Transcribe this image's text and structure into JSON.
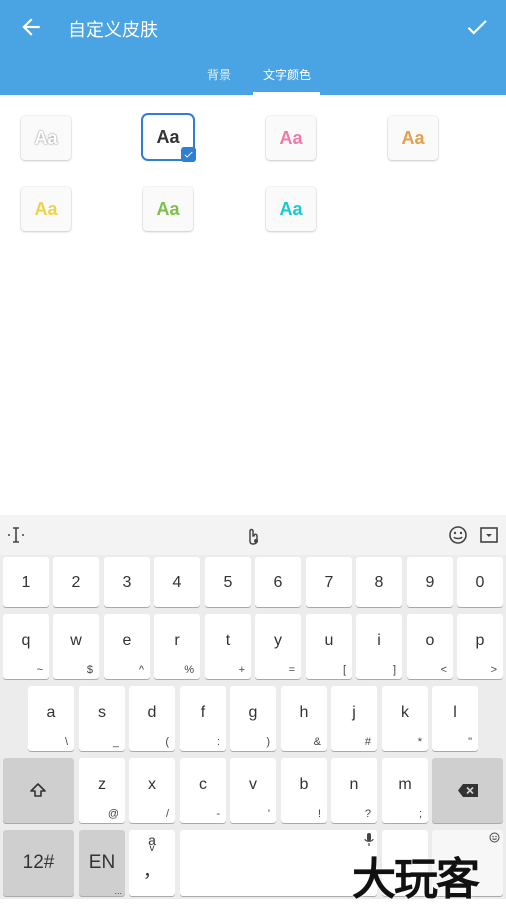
{
  "appbar": {
    "title": "自定义皮肤",
    "back_icon": "arrow-left-icon",
    "confirm_icon": "check-icon",
    "color": "#4aa3e3"
  },
  "tabs": [
    {
      "label": "背景",
      "active": false
    },
    {
      "label": "文字颜色",
      "active": true
    }
  ],
  "swatches": [
    {
      "label": "Aa",
      "color": "#ffffff",
      "outline": true,
      "selected": false
    },
    {
      "label": "Aa",
      "color": "#333333",
      "selected": true
    },
    {
      "label": "Aa",
      "color": "#f07aa6",
      "selected": false
    },
    {
      "label": "Aa",
      "color": "#e3a04a",
      "selected": false
    },
    {
      "label": "Aa",
      "color": "#eed34a",
      "selected": false
    },
    {
      "label": "Aa",
      "color": "#7cc04a",
      "selected": false
    },
    {
      "label": "Aa",
      "color": "#19c9d2",
      "selected": false
    }
  ],
  "keyboard": {
    "toolbar_icons": [
      "cursor-icon",
      "handwriting-icon",
      "emoji-icon",
      "hide-keyboard-icon"
    ],
    "numbers": [
      "1",
      "2",
      "3",
      "4",
      "5",
      "6",
      "7",
      "8",
      "9",
      "0"
    ],
    "row1": [
      {
        "m": "q",
        "s": "~"
      },
      {
        "m": "w",
        "s": "$"
      },
      {
        "m": "e",
        "s": "^"
      },
      {
        "m": "r",
        "s": "%"
      },
      {
        "m": "t",
        "s": "+"
      },
      {
        "m": "y",
        "s": "="
      },
      {
        "m": "u",
        "s": "["
      },
      {
        "m": "i",
        "s": "]"
      },
      {
        "m": "o",
        "s": "<"
      },
      {
        "m": "p",
        "s": ">"
      }
    ],
    "row2": [
      {
        "m": "a",
        "s": "\\"
      },
      {
        "m": "s",
        "s": "_"
      },
      {
        "m": "d",
        "s": "("
      },
      {
        "m": "f",
        "s": ":"
      },
      {
        "m": "g",
        "s": ")"
      },
      {
        "m": "h",
        "s": "&"
      },
      {
        "m": "j",
        "s": "#"
      },
      {
        "m": "k",
        "s": "*"
      },
      {
        "m": "l",
        "s": "\""
      }
    ],
    "row3": [
      {
        "m": "z",
        "s": "@"
      },
      {
        "m": "x",
        "s": "/"
      },
      {
        "m": "c",
        "s": "-"
      },
      {
        "m": "v",
        "s": "'"
      },
      {
        "m": "b",
        "s": "!"
      },
      {
        "m": "n",
        "s": "?"
      },
      {
        "m": "m",
        "s": ";"
      }
    ],
    "shift_icon": "shift-icon",
    "backspace_icon": "backspace-icon",
    "symbols_label": "12#",
    "lang_label": "EN",
    "lang_sub": "...",
    "punct_main": "，",
    "punct_top": "a",
    "punct_sub": "v",
    "mic_icon": "mic-icon",
    "emoji_corner_icon": "emoji-icon"
  },
  "watermark": "大玩客"
}
